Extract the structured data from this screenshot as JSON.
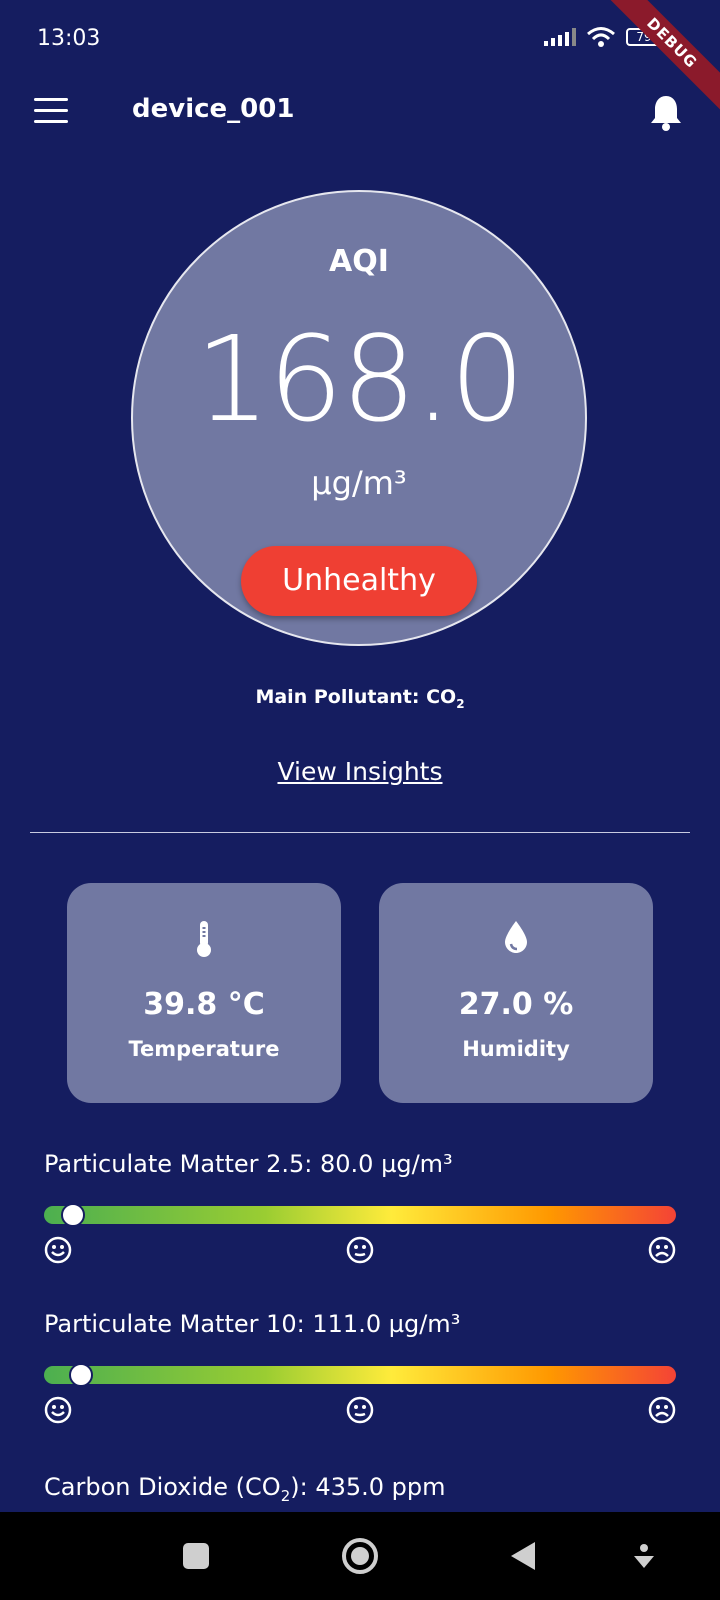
{
  "status_bar": {
    "time": "13:03",
    "battery": "79"
  },
  "debug_banner": "DEBUG",
  "app_bar": {
    "title": "device_001"
  },
  "aqi": {
    "label": "AQI",
    "value": "168.0",
    "unit": "µg/m³",
    "status": "Unhealthy",
    "main_pollutant_prefix": "Main Pollutant: CO",
    "main_pollutant_sub": "2"
  },
  "view_insights": "View Insights",
  "metrics": [
    {
      "value": "39.8 °C",
      "label": "Temperature",
      "icon": "thermometer-icon"
    },
    {
      "value": "27.0 %",
      "label": "Humidity",
      "icon": "water-drop-icon"
    }
  ],
  "pollutants": [
    {
      "label": "Particulate Matter 2.5: 80.0 µg/m³",
      "level_fraction": 0.027
    },
    {
      "label": "Particulate Matter 10: 111.0 µg/m³",
      "level_fraction": 0.039
    },
    {
      "label_prefix": "Carbon Dioxide (CO",
      "label_sub": "2",
      "label_suffix": "): 435.0 ppm"
    }
  ],
  "gauge_faces": [
    "smile-face-icon",
    "neutral-face-icon",
    "sad-face-icon"
  ],
  "nav_bar": [
    "recents-square-icon",
    "home-circle-icon",
    "back-triangle-icon",
    "assist-down-icon"
  ],
  "colors": {
    "background": "#151d60",
    "card": "#7178a2",
    "status_unhealthy": "#ef3f33"
  }
}
